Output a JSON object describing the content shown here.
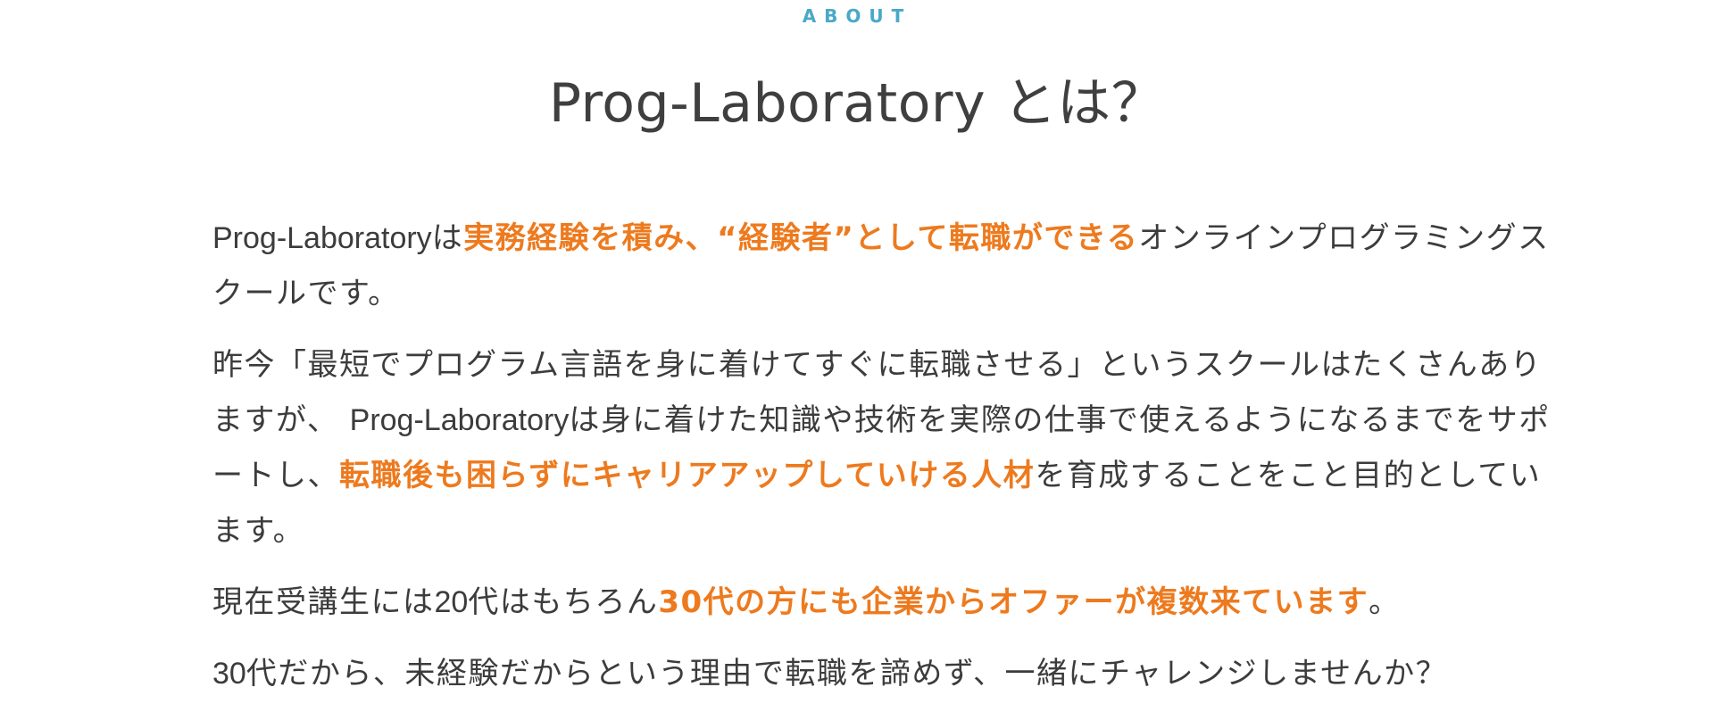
{
  "section": {
    "eyebrow": "ABOUT",
    "title": "Prog-Laboratory とは？"
  },
  "paragraphs": {
    "p1": {
      "brand": "Prog-Laboratory",
      "t1": "は",
      "highlight": "実務経験を積み、“経験者”として転職ができる",
      "t2": "オンラインプログラミングスクールです。"
    },
    "p2": {
      "t1": "昨今「最短でプログラム言語を身に着けてすぐに転職させる」というスクールはたくさんありますが、 ",
      "brand": "Prog-Laboratory",
      "t2": "は身に着けた知識や技術を実際の仕事で使えるようになるまでをサポートし、",
      "highlight": "転職後も困らずにキャリアアップしていける人材",
      "t3": "を育成することをこと目的としています。"
    },
    "p3": {
      "t1": "現在受講生には",
      "num": "20",
      "t2": "代はもちろん",
      "highlight": "30代の方にも企業からオファーが複数来ています",
      "t3": "。"
    },
    "p4": {
      "num": "30",
      "t1": "代だから、未経験だからという理由で転職を諦めず、一緒にチャレンジしませんか？"
    }
  },
  "colors": {
    "accent": "#ed7a1e",
    "eyebrow": "#4aa8c8",
    "text": "#3c3c3c"
  }
}
